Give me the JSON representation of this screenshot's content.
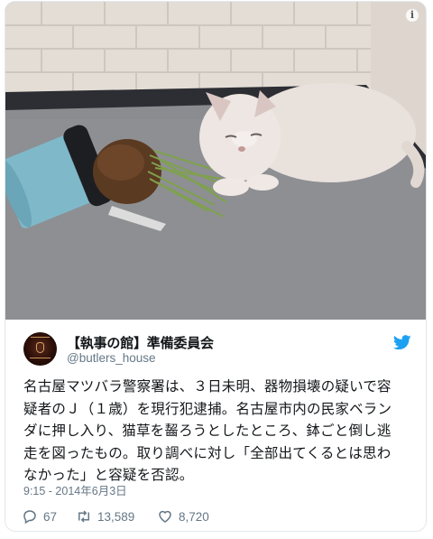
{
  "tweet": {
    "author_name": "【執事の館】準備委員会",
    "author_handle": "@butlers_house",
    "text_lines": [
      "名古屋マツバラ警察署は、３日未明、器物損壊の疑いで容",
      "疑者のＪ（１歳）を現行犯逮捕。名古屋市内の民家ベラン",
      "ダに押し入り、猫草を齧ろうとしたところ、鉢ごと倒し逃",
      "走を図ったもの。取り調べに対し「全部出てくるとは思わ",
      "なかった」と容疑を否認。"
    ],
    "timestamp": "9:15 - 2014年6月3日",
    "reply_count": "67",
    "retweet_count": "13,589",
    "like_count": "8,720"
  },
  "media": {
    "info_glyph": "i",
    "alt": "cat-and-knocked-over-cat-grass-pot-photo"
  },
  "colors": {
    "twitter_blue": "#1da1f2",
    "text": "#14171a",
    "secondary": "#657786"
  },
  "icons": {
    "info": "info-icon",
    "bird": "twitter-bird-icon",
    "reply": "reply-icon",
    "retweet": "retweet-icon",
    "like": "heart-icon"
  }
}
